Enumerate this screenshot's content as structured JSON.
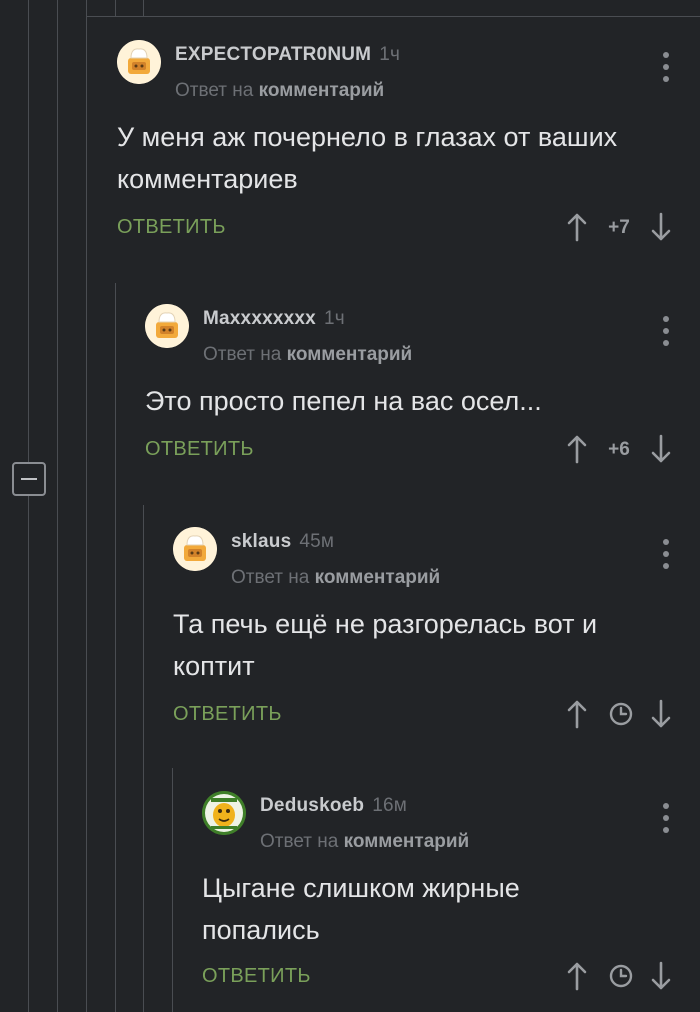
{
  "comments": [
    {
      "author": "EXPECTOPATR0NUM",
      "time": "1ч",
      "reply_prefix": "Ответ на",
      "reply_target": "комментарий",
      "lines": [
        "У меня аж почернело в глазах от ваших",
        "комментариев"
      ],
      "reply_label": "ОТВЕТИТЬ",
      "rating": "+7",
      "avatar": "default-avatar-icon"
    },
    {
      "author": "Maxxxxxxxx",
      "time": "1ч",
      "reply_prefix": "Ответ на",
      "reply_target": "комментарий",
      "lines": [
        "Это просто пепел на вас осел..."
      ],
      "reply_label": "ОТВЕТИТЬ",
      "rating": "+6",
      "avatar": "default-avatar-icon"
    },
    {
      "author": "sklaus",
      "time": "45м",
      "reply_prefix": "Ответ на",
      "reply_target": "комментарий",
      "lines": [
        "Та печь ещё не разгорелась вот и",
        "коптит"
      ],
      "reply_label": "ОТВЕТИТЬ",
      "rating": "",
      "avatar": "default-avatar-icon"
    },
    {
      "author": "Deduskoeb",
      "time": "16м",
      "reply_prefix": "Ответ на",
      "reply_target": "комментарий",
      "lines": [
        "Цыгане слишком жирные",
        "попались"
      ],
      "reply_label": "ОТВЕТИТЬ",
      "rating": "",
      "avatar": "cartoon-avatar-icon"
    }
  ],
  "colors": {
    "background": "#222427",
    "text": "#e4e5e7",
    "muted": "#6d7075",
    "reply_green": "#7aa05a",
    "thread_line": "#4a4d52"
  }
}
